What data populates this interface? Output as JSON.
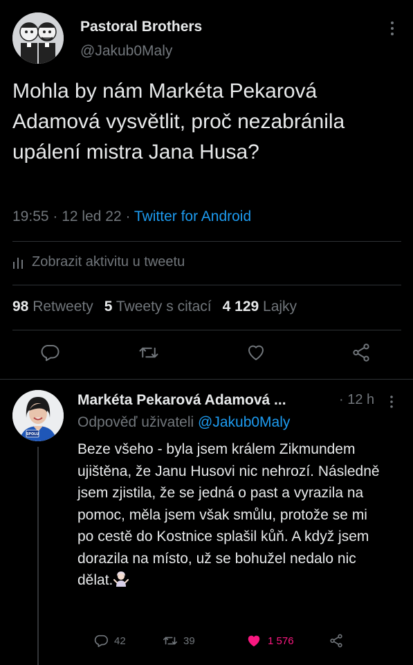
{
  "tweet": {
    "author_name": "Pastoral Brothers",
    "author_handle": "@Jakub0Maly",
    "text": "Mohla by nám Markéta Pekarová Adamová vysvětlit, proč nezabránila upálení mistra Jana Husa?",
    "time": "19:55 · 12 led 22 · ",
    "app": "Twitter for Android",
    "activity_label": "Zobrazit aktivitu u tweetu",
    "stats": {
      "retweets_count": "98",
      "retweets_label": "Retweety",
      "quotes_count": "5",
      "quotes_label": "Tweety s citací",
      "likes_count": "4 129",
      "likes_label": "Lajky"
    },
    "actions": [
      "reply-icon",
      "retweet-icon",
      "like-icon",
      "share-icon"
    ]
  },
  "reply": {
    "author_name": "Markéta Pekarová Adamová ...",
    "time": "· 12 h",
    "reply_to_label": "Odpověď uživateli",
    "reply_to_handle": "@Jakub0Maly",
    "text": "Beze všeho - byla jsem králem Zikmundem ujištěna, že Janu Husovi nic nehrozí. Následně jsem zjistila, že se jedná o past a vyrazila na pomoc, měla jsem však smůlu, protože se mi po cestě do Kostnice splašil kůň. A když jsem dorazila na místo, už se bohužel nedalo nic dělat.",
    "avatar_badge": "SPOLU",
    "counts": {
      "replies": "42",
      "retweets": "39",
      "likes": "1 576"
    },
    "liked": true
  },
  "colors": {
    "background": "#000000",
    "text": "#e7e9ea",
    "secondary": "#71767b",
    "link": "#1d9bf0",
    "like": "#f91880",
    "divider": "#2f3336"
  }
}
